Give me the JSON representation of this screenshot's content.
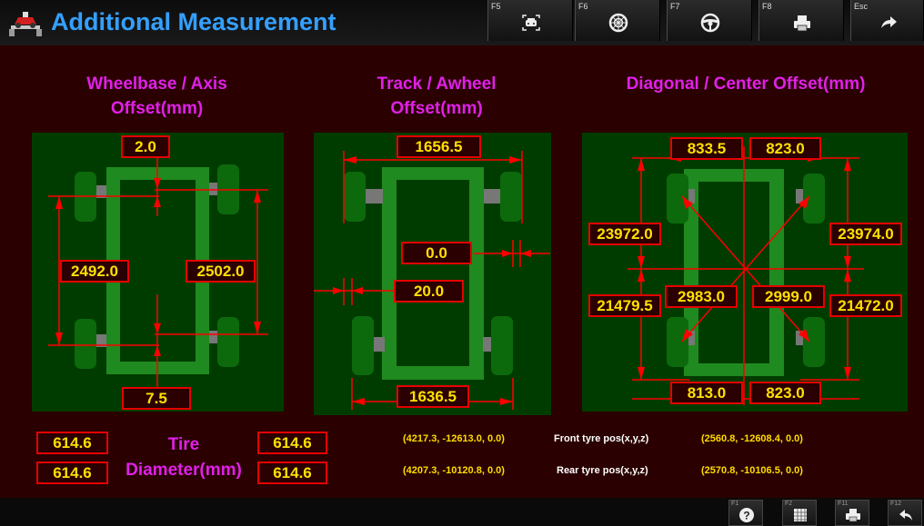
{
  "header": {
    "title": "Additional Measurement",
    "fkeys": [
      {
        "key": "F5",
        "icon": "vehicle-front-icon"
      },
      {
        "key": "F6",
        "icon": "tire-icon"
      },
      {
        "key": "F7",
        "icon": "steering-wheel-icon"
      },
      {
        "key": "F8",
        "icon": "printer-icon"
      },
      {
        "key": "Esc",
        "icon": "forward-arrow-icon"
      }
    ]
  },
  "wheelbase": {
    "heading": "Wheelbase / Axis Offset(mm)",
    "front_axis_offset": "2.0",
    "left_wheelbase": "2492.0",
    "right_wheelbase": "2502.0",
    "rear_axis_offset": "7.5"
  },
  "track": {
    "heading": "Track / Awheel Offset(mm)",
    "front_track": "1656.5",
    "front_offset": "0.0",
    "rear_offset": "20.0",
    "rear_track": "1636.5"
  },
  "diagonal": {
    "heading": "Diagonal / Center Offset(mm)",
    "top_left": "833.5",
    "top_right": "823.0",
    "left_upper": "23972.0",
    "right_upper": "23974.0",
    "diag_left": "2983.0",
    "diag_right": "2999.0",
    "left_lower": "21479.5",
    "right_lower": "21472.0",
    "bottom_left": "813.0",
    "bottom_right": "823.0"
  },
  "tire": {
    "label_line1": "Tire",
    "label_line2": "Diameter(mm)",
    "front_left": "614.6",
    "front_right": "614.6",
    "rear_left": "614.6",
    "rear_right": "614.6"
  },
  "positions": {
    "front_label": "Front tyre pos(x,y,z)",
    "rear_label": "Rear tyre pos(x,y,z)",
    "front_left": "(4217.3, -12613.0, 0.0)",
    "front_right": "(2560.8, -12608.4, 0.0)",
    "rear_left": "(4207.3, -10120.8, 0.0)",
    "rear_right": "(2570.8, -10106.5, 0.0)"
  },
  "footer": {
    "keys": [
      {
        "key": "F1",
        "icon": "help-icon"
      },
      {
        "key": "F2",
        "icon": "table-icon"
      },
      {
        "key": "F11",
        "icon": "printer-icon"
      },
      {
        "key": "F12",
        "icon": "back-arrow-icon"
      }
    ]
  },
  "colors": {
    "background": "#2a0000",
    "title": "#34a0ff",
    "heading": "#e020e8",
    "value_text": "#ffe000",
    "value_border": "#e60000",
    "panel": "#003c00",
    "chassis": "#1f8a1f",
    "wheel": "#0c6a0c",
    "dimension_line": "#ff0000"
  }
}
